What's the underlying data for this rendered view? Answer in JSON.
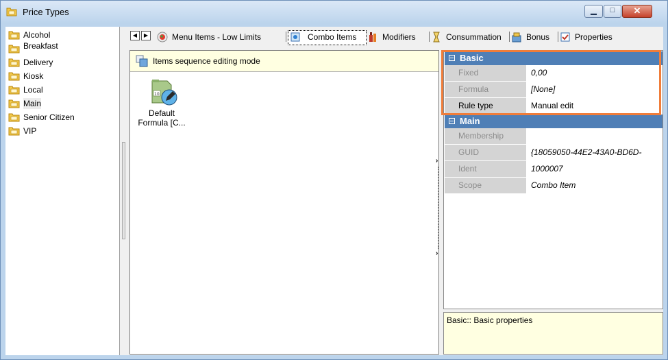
{
  "window": {
    "title": "Price Types"
  },
  "tree": {
    "items": [
      {
        "label": "Alcohol"
      },
      {
        "label": "Breakfast"
      },
      {
        "label": "Delivery"
      },
      {
        "label": "Kiosk"
      },
      {
        "label": "Local"
      },
      {
        "label": "Main"
      },
      {
        "label": "Senior Citizen"
      },
      {
        "label": "VIP"
      }
    ],
    "selected": "Main"
  },
  "tabs": [
    {
      "label": "Menu Items - Low Limits",
      "icon": "menu-items-icon"
    },
    {
      "label": "Combo Items",
      "icon": "combo-items-icon"
    },
    {
      "label": "Modifiers",
      "icon": "modifiers-icon"
    },
    {
      "label": "Consummation",
      "icon": "consummation-icon"
    },
    {
      "label": "Bonus",
      "icon": "bonus-icon"
    },
    {
      "label": "Properties",
      "icon": "properties-icon"
    }
  ],
  "active_tab": "Combo Items",
  "content": {
    "mode_text": "Items sequence editing mode",
    "item_label_line1": "Default",
    "item_label_line2": "Formula [C..."
  },
  "properties": {
    "categories": [
      {
        "name": "Basic",
        "rows": [
          {
            "name": "Fixed",
            "value": "0,00"
          },
          {
            "name": "Formula",
            "value": "[None]"
          },
          {
            "name": "Rule type",
            "value": "Manual edit"
          }
        ]
      },
      {
        "name": "Main",
        "rows": [
          {
            "name": "Membership",
            "value": ""
          },
          {
            "name": "GUID",
            "value": "{18059050-44E2-43A0-BD6D-"
          },
          {
            "name": "Ident",
            "value": "1000007"
          },
          {
            "name": "Scope",
            "value": "Combo Item"
          }
        ]
      }
    ]
  },
  "help": {
    "text": "Basic:: Basic properties"
  },
  "colors": {
    "category_header": "#4f7fb6",
    "highlight_border": "#f07d3a",
    "info_background": "#ffffe1"
  }
}
